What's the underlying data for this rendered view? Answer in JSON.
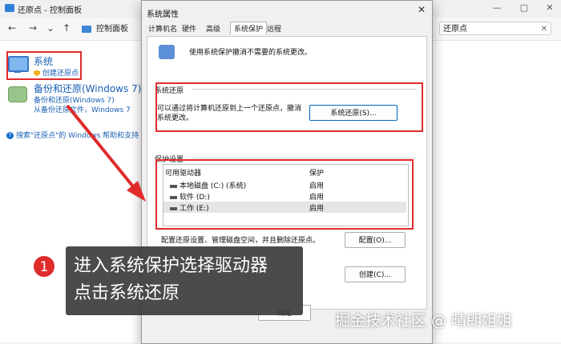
{
  "background_window": {
    "title": "还原点 - 控制面板",
    "breadcrumb": "控制面板",
    "search_value": "还原点",
    "controls": [
      "—",
      "▢",
      "✕"
    ],
    "system_item": {
      "title": "系统",
      "link": "创建还原点"
    },
    "backup_item": {
      "title": "备份和还原(Windows 7)",
      "link1": "备份和还原(Windows 7)",
      "link2": "从备份还原文件，Windows 7"
    },
    "help_link": "搜索\"还原点\"的 Windows 帮助和支持"
  },
  "dialog": {
    "title": "系统属性",
    "tabs": [
      "计算机名",
      "硬件",
      "高级",
      "系统保护",
      "远程"
    ],
    "active_tab": "系统保护",
    "intro": "使用系统保护撤消不需要的系统更改。",
    "restore_group": "系统还原",
    "restore_desc": "可以通过将计算机还原到上一个还原点，撤消系统更改。",
    "restore_button": "系统还原(S)...",
    "protection_group": "保护设置",
    "drive_columns": [
      "可用驱动器",
      "保护"
    ],
    "drives": [
      {
        "name": "本地磁盘 (C:) (系统)",
        "protection": "启用"
      },
      {
        "name": "软件 (D:)",
        "protection": "启用"
      },
      {
        "name": "工作 (E:)",
        "protection": "启用"
      }
    ],
    "config_text": "配置还原设置、管理磁盘空间，并且删除还原点。",
    "config_button": "配置(O)...",
    "create_button": "创建(C)...",
    "ok_button": "确定"
  },
  "annotation": {
    "step": "1",
    "line1": "进入系统保护选择驱动器",
    "line2": "点击系统还原"
  },
  "watermark": "掘金技术社区 @ 晴朗姐姐",
  "colors": {
    "highlight": "#e02b2b",
    "link": "#1a5fb4",
    "callout_bg": "#3c3c3c"
  }
}
